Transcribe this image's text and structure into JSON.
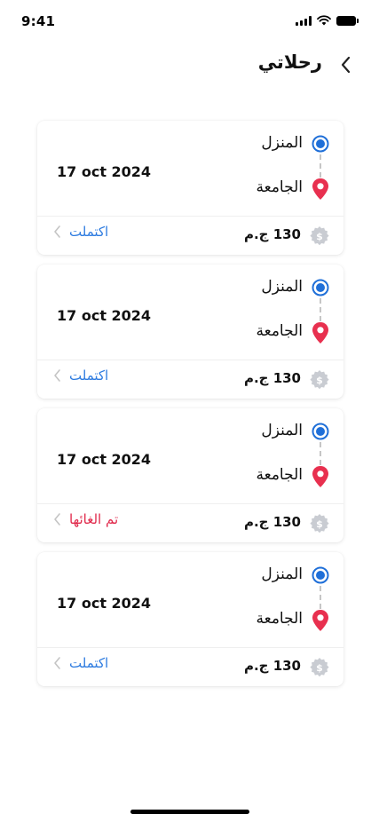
{
  "status_bar": {
    "time": "9:41"
  },
  "header": {
    "title": "رحلاتي",
    "back_icon": "chevron-right-icon"
  },
  "colors": {
    "origin_blue": "#1f6fd8",
    "destination_red": "#e8304f",
    "completed_blue": "#2d7be0",
    "cancelled_red": "#e0284a",
    "price_icon_gray": "#c9ccd2"
  },
  "trips": [
    {
      "origin": "المنزل",
      "destination": "الجامعة",
      "date": "17 oct 2024",
      "price": "130 ج.م",
      "status": "اكتملت",
      "status_type": "completed"
    },
    {
      "origin": "المنزل",
      "destination": "الجامعة",
      "date": "17 oct 2024",
      "price": "130 ج.م",
      "status": "اكتملت",
      "status_type": "completed"
    },
    {
      "origin": "المنزل",
      "destination": "الجامعة",
      "date": "17 oct 2024",
      "price": "130 ج.م",
      "status": "تم الغائها",
      "status_type": "cancelled"
    },
    {
      "origin": "المنزل",
      "destination": "الجامعة",
      "date": "17 oct 2024",
      "price": "130 ج.م",
      "status": "اكتملت",
      "status_type": "completed"
    }
  ]
}
